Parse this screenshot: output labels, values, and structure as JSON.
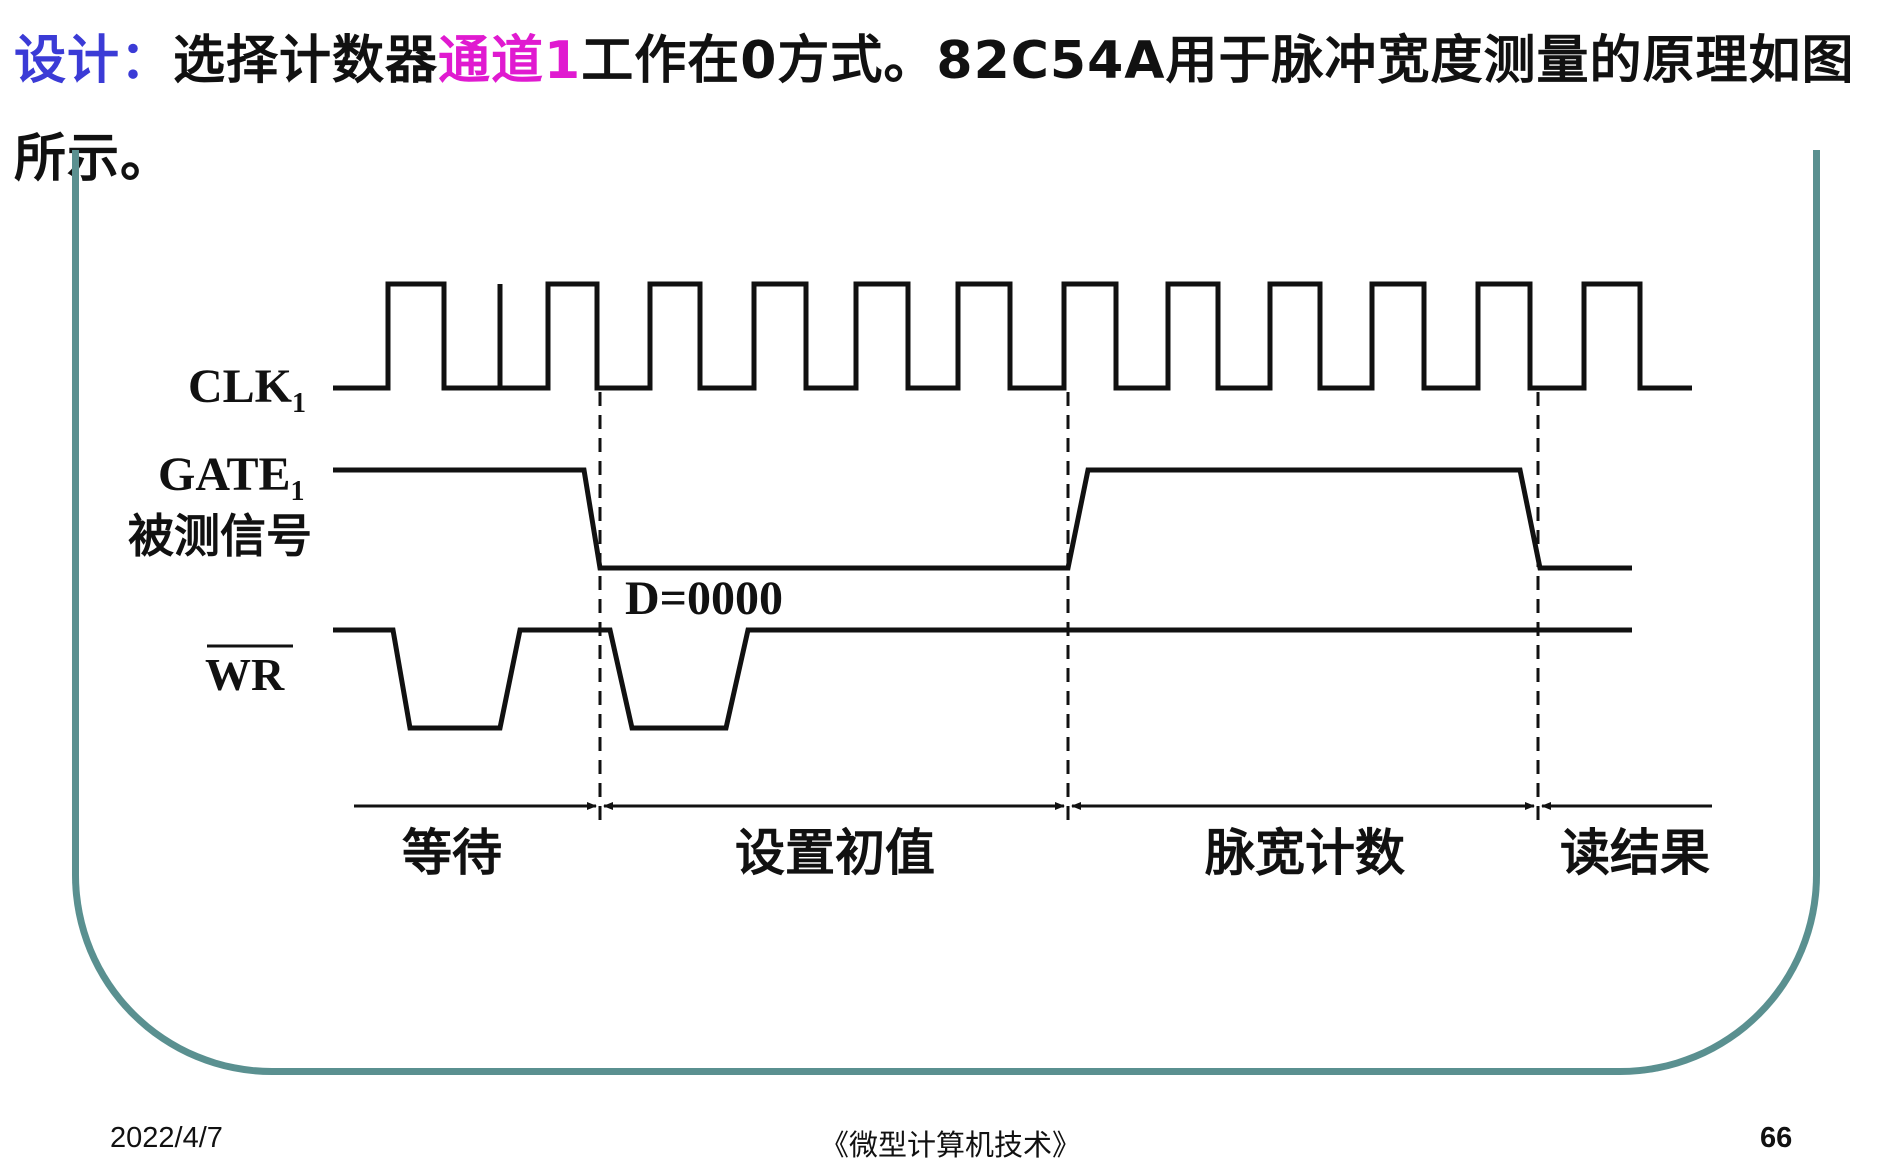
{
  "slide": {
    "heading": {
      "lead": "设计：",
      "pre": "选择计数器",
      "highlight": "通道1",
      "post": "工作在0方式。82C54A用于脉冲宽度测量的原理如图所示。"
    },
    "footer": {
      "date": "2022/4/7",
      "book": "《微型计算机技术》",
      "page": "66"
    }
  },
  "diagram": {
    "signals": {
      "clk": {
        "name": "CLK",
        "sub": "1"
      },
      "gate": {
        "name": "GATE",
        "sub": "1",
        "note": "被测信号"
      },
      "wr": {
        "name": "WR"
      }
    },
    "value_label": "D=0000",
    "phases": [
      "等待",
      "设置初值",
      "脉宽计数",
      "读结果"
    ]
  },
  "colors": {
    "lead": "#3b3bd6",
    "highlight": "#e01ad0",
    "frame": "#5a9090",
    "ink": "#111111"
  }
}
